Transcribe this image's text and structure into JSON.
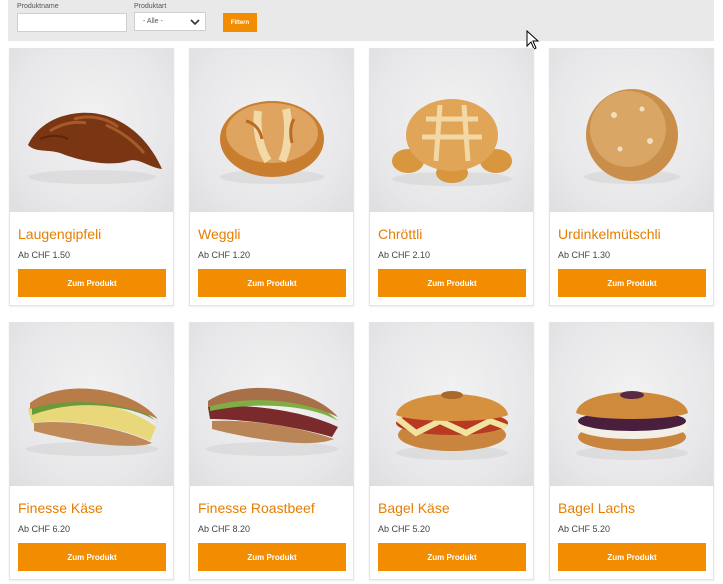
{
  "filter": {
    "name_label": "Produktname",
    "name_value": "",
    "type_label": "Produktart",
    "type_selected": "- Alle -",
    "button_label": "Filtern"
  },
  "products": [
    {
      "name": "Laugengipfeli",
      "price": "Ab CHF 1.50",
      "button": "Zum Produkt"
    },
    {
      "name": "Weggli",
      "price": "Ab CHF 1.20",
      "button": "Zum Produkt"
    },
    {
      "name": "Chröttli",
      "price": "Ab CHF 2.10",
      "button": "Zum Produkt"
    },
    {
      "name": "Urdinkelmütschli",
      "price": "Ab CHF 1.30",
      "button": "Zum Produkt"
    },
    {
      "name": "Finesse Käse",
      "price": "Ab CHF 6.20",
      "button": "Zum Produkt"
    },
    {
      "name": "Finesse Roastbeef",
      "price": "Ab CHF 8.20",
      "button": "Zum Produkt"
    },
    {
      "name": "Bagel Käse",
      "price": "Ab CHF 5.20",
      "button": "Zum Produkt"
    },
    {
      "name": "Bagel Lachs",
      "price": "Ab CHF 5.20",
      "button": "Zum Produkt"
    }
  ],
  "colors": {
    "accent": "#f28c00",
    "title": "#e67e00",
    "filter_bar": "#e9e9e9"
  }
}
